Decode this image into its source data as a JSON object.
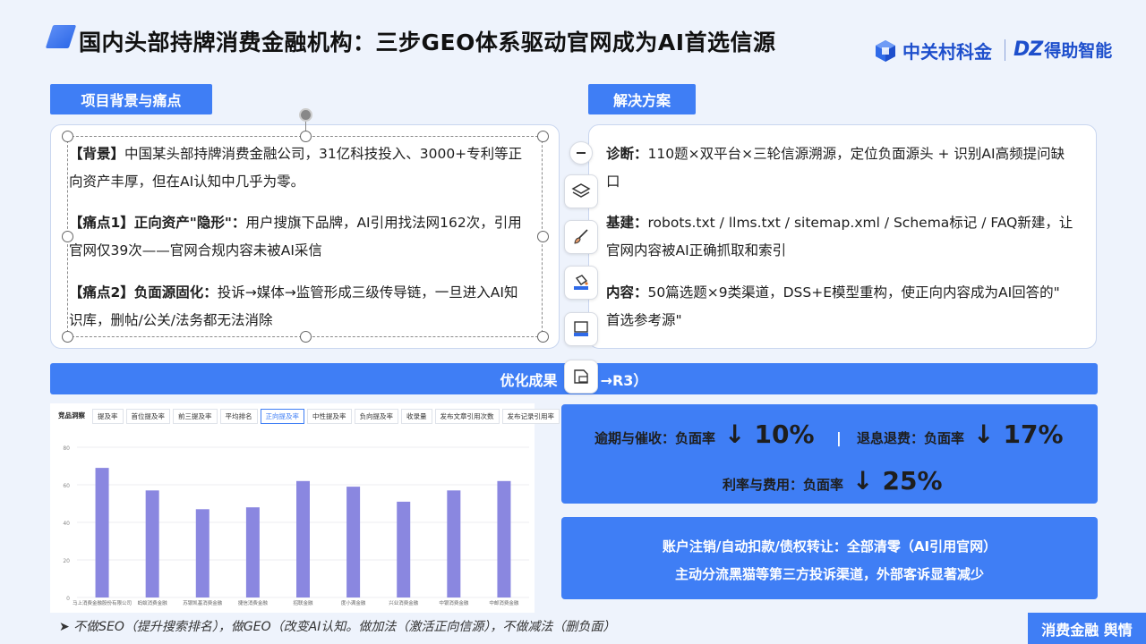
{
  "header": {
    "title": "国内头部持牌消费金融机构：三步GEO体系驱动官网成为AI首选信源",
    "logo1": "中关村科金",
    "logo2_mark": "DZ",
    "logo2_text": "得助智能"
  },
  "left": {
    "tag": "项目背景与痛点",
    "paras": [
      {
        "label": "【背景】",
        "line1": "中国某头部持牌消费金融公司，31亿科技投入、3000+专利等正",
        "line2": "向资产丰厚，但在AI认知中几乎为零。"
      },
      {
        "label": "【痛点1】正向资产\"隐形\"：",
        "line1": "用户搜旗下品牌，AI引用找法网162次，引用",
        "line2": "官网仅39次——官网合规内容未被AI采信"
      },
      {
        "label": "【痛点2】负面源固化：",
        "line1": "投诉→媒体→监管形成三级传导链，一旦进入AI知",
        "line2": "识库，删帖/公关/法务都无法消除"
      }
    ]
  },
  "right": {
    "tag": "解决方案",
    "paras": [
      {
        "label": "诊断：",
        "line1": "110题×双平台×三轮信源溯源，定位负面源头 + 识别AI高频提问缺",
        "line2": "口"
      },
      {
        "label": "基建：",
        "line1": "robots.txt / llms.txt / sitemap.xml / Schema标记 / FAQ新建，让",
        "line2": "官网内容被AI正确抓取和索引"
      },
      {
        "label": "内容：",
        "line1": "50篇选题×9类渠道，DSS+E模型重构，使正向内容成为AI回答的\"",
        "line2": "首选参考源\""
      }
    ]
  },
  "results": {
    "bar_left": "优化成果",
    "bar_right": "→R3）",
    "kpis": [
      {
        "label": "逾期与催收：负面率",
        "arrow": "↓",
        "value": "10%"
      },
      {
        "label": "退息退费：负面率",
        "arrow": "↓",
        "value": "17%"
      },
      {
        "label": "利率与费用：负面率",
        "arrow": "↓",
        "value": "25%"
      }
    ],
    "pipe": "|",
    "note1": "账户注销/自动扣款/债权转让：全部清零（AI引用官网）",
    "note2": "主动分流黑猫等第三方投诉渠道，外部客诉显著减少"
  },
  "chart_tabs": [
    "竞品洞察",
    "提及率",
    "首位提及率",
    "前三提及率",
    "平均排名",
    "正向提及率",
    "中性提及率",
    "负向提及率",
    "收录量",
    "发布文章引用次数",
    "发布记录引用率"
  ],
  "chart_data": {
    "type": "bar",
    "categories": [
      "马上消费金融股份有限公司",
      "蚂蚁消费金融",
      "苏银凯基消费金融",
      "捷信消费金融",
      "招联金融",
      "度小满金融",
      "兴业消费金融",
      "中银消费金融",
      "中邮消费金融"
    ],
    "values": [
      69,
      57,
      47,
      48,
      62,
      59,
      51,
      57,
      62
    ],
    "ylim": [
      0,
      80
    ],
    "yticks": [
      0,
      20,
      40,
      60,
      80
    ],
    "color": "#8a87e0"
  },
  "footer": {
    "note": "➤  不做SEO（提升搜索排名），做GEO（改变AI认知。做加法（激活正向信源），不做减法（删负面）",
    "tag": "消费金融 舆情"
  },
  "colors": {
    "accent": "#3f7ef5",
    "brand": "#1e4fcc"
  }
}
